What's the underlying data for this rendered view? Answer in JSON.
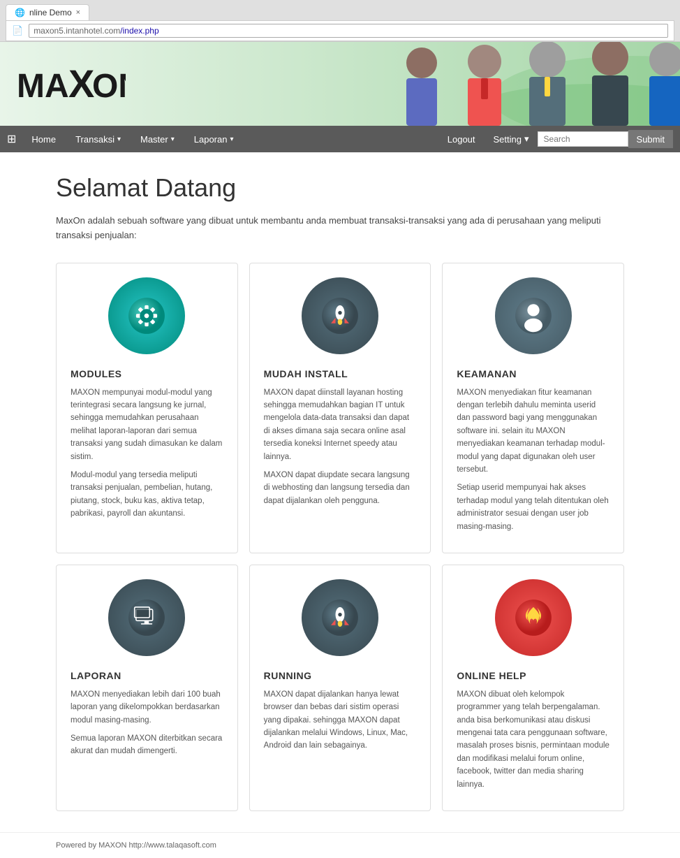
{
  "browser": {
    "tab_title": "nline Demo",
    "tab_close": "×",
    "address_scheme": "maxon5.intanhotel.com",
    "address_path": "/index.php"
  },
  "navbar": {
    "grid_icon": "⊞",
    "home_label": "Home",
    "transaksi_label": "Transaksi",
    "master_label": "Master",
    "laporan_label": "Laporan",
    "logout_label": "Logout",
    "setting_label": "Setting",
    "search_placeholder": "Search",
    "submit_label": "Submit"
  },
  "header": {
    "logo": "MAXON"
  },
  "main": {
    "welcome_title": "Selamat Datang",
    "welcome_desc": "MaxOn adalah sebuah software yang dibuat untuk membantu anda membuat transaksi-transaksi yang ada di perusahaan yang meliputi transaksi penjualan:"
  },
  "cards": [
    {
      "id": "modules",
      "title": "MODULES",
      "icon_type": "gear",
      "icon_color": "teal",
      "text1": "MAXON mempunyai modul-modul yang terintegrasi secara langsung ke jurnal, sehingga memudahkan perusahaan melihat laporan-laporan dari semua transaksi yang sudah dimasukan ke dalam sistim.",
      "text2": "Modul-modul yang tersedia meliputi transaksi penjualan, pembelian, hutang, piutang, stock, buku kas, aktiva tetap, pabrikasi, payroll dan akuntansi."
    },
    {
      "id": "mudah-install",
      "title": "MUDAH INSTALL",
      "icon_type": "rocket",
      "icon_color": "darkblue",
      "text1": "MAXON dapat diinstall layanan hosting sehingga memudahkan bagian IT untuk mengelola data-data transaksi dan dapat di akses dimana saja secara online asal tersedia koneksi Internet speedy atau lainnya.",
      "text2": "MAXON dapat diupdate secara langsung di webhosting dan langsung tersedia dan dapat dijalankan oleh pengguna."
    },
    {
      "id": "keamanan",
      "title": "KEAMANAN",
      "icon_type": "user",
      "icon_color": "gray",
      "text1": "MAXON menyediakan fitur keamanan dengan terlebih dahulu meminta userid dan password bagi yang menggunakan software ini. selain itu MAXON menyediakan keamanan terhadap modul-modul yang dapat digunakan oleh user tersebut.",
      "text2": "Setiap userid mempunyai hak akses terhadap modul yang telah ditentukan oleh administrator sesuai dengan user job masing-masing."
    },
    {
      "id": "laporan",
      "title": "LAPORAN",
      "icon_type": "monitor",
      "icon_color": "darkteal",
      "text1": "MAXON menyediakan lebih dari 100 buah laporan yang dikelompokkan berdasarkan modul masing-masing.",
      "text2": "Semua laporan MAXON diterbitkan secara akurat dan mudah dimengerti."
    },
    {
      "id": "running",
      "title": "RUNNING",
      "icon_type": "rocket",
      "icon_color": "darkblue",
      "text1": "MAXON dapat dijalankan hanya lewat browser dan bebas dari sistim operasi yang dipakai. sehingga MAXON dapat dijalankan melalui Windows, Linux, Mac, Android dan lain sebagainya.",
      "text2": ""
    },
    {
      "id": "online-help",
      "title": "ONLINE HELP",
      "icon_type": "flame",
      "icon_color": "red",
      "text1": "MAXON dibuat oleh kelompok programmer yang telah berpengalaman. anda bisa berkomunikasi atau diskusi mengenai tata cara penggunaan software, masalah proses bisnis, permintaan module dan modifikasi melalui forum online, facebook, twitter dan media sharing lainnya.",
      "text2": ""
    }
  ],
  "footer": {
    "text": "Powered by MAXON http://www.talaqasoft.com"
  }
}
